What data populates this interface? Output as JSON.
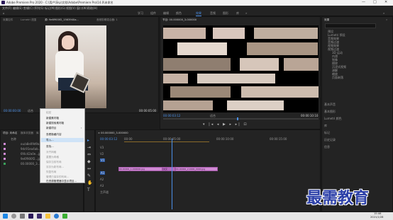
{
  "app_title": "Adobe Premiere Pro 2020 - C:\\用户\\Sky\\文档\\Adobe\\Premiere Pro\\14.0\\未命名",
  "window_controls": [
    "—",
    "□",
    "✕"
  ],
  "menu": [
    "文件(F)",
    "编辑(E)",
    "剪辑(C)",
    "序列(S)",
    "标记(M)",
    "图形(G)",
    "视图(V)",
    "窗口(W)",
    "帮助(H)"
  ],
  "workspaces": [
    "学习",
    "组件",
    "编辑",
    "颜色",
    "效果",
    "音频",
    "图形",
    "库",
    "»"
  ],
  "active_workspace": "效果",
  "source_panel": {
    "tabs": [
      "效果控件",
      "Lumetri 范围",
      "源: 9e6f900f2_1563940a...",
      "音频剪辑混合器: 1"
    ],
    "timecode": "00:00:00:00",
    "fit": "适合",
    "duration": "00:00:05:00"
  },
  "program_panel": {
    "tab": "节目: 00.000000_3-000000",
    "timecode": "00:00:03:12",
    "fit": "适合",
    "duration": "00:00:10:10"
  },
  "effects_panel": {
    "tabs": [
      "效果",
      "»"
    ],
    "search_placeholder": "",
    "items": [
      "预设",
      "Lumetri 预设",
      "音频效果",
      "音频过渡",
      "视频效果",
      "视频过渡",
      "3D 运动",
      "内滑",
      "划像",
      "擦除",
      "沉浸式视频",
      "溶解",
      "缩放",
      "页面剥落"
    ],
    "bottom_items": [
      "基本声音",
      "基本图形",
      "Lumetri 颜色",
      "库",
      "标记",
      "历史记录",
      "信息"
    ]
  },
  "project_panel": {
    "tabs": [
      "项目: 未命名",
      "媒体浏览器",
      "库",
      "信息",
      "»"
    ],
    "name_col": "名称",
    "files": [
      "ou/a8e09d9a...jpg",
      "9dc91ea4ab...jpg",
      "6f4c42a0e...jpg",
      "9e6f900f2...jpg",
      "00.00000_3..."
    ]
  },
  "timeline": {
    "tab": "× 00.000000_3-000000",
    "timecode": "00:00:03:12",
    "ruler": [
      "00:00",
      "00:00:05:00",
      "00:00:10:00",
      "00:00:15:00"
    ],
    "tracks": [
      "V3",
      "V2",
      "V1",
      "A1",
      "A2",
      "A3",
      "主声道"
    ],
    "clips": [
      "00.00000_1-000000.jpg",
      "交叉",
      "00.00000_2-0000_0000.jpg"
    ]
  },
  "context_menu": {
    "items": [
      {
        "label": "粘贴",
        "enabled": false
      },
      {
        "label": "新建素材箱",
        "enabled": true
      },
      {
        "label": "新建搜索素材箱",
        "enabled": true
      },
      {
        "label": "新建项目",
        "enabled": true,
        "submenu": true
      },
      {
        "label": "查看隐藏内容",
        "enabled": true
      },
      {
        "label": "导入...",
        "enabled": true,
        "highlighted": true
      },
      {
        "label": "查找...",
        "enabled": true
      },
      {
        "label": "对齐网格",
        "enabled": false
      },
      {
        "label": "重置为网格",
        "enabled": false
      },
      {
        "label": "保存当前布局",
        "enabled": false
      },
      {
        "label": "另存为新布局...",
        "enabled": false
      },
      {
        "label": "恢复布局",
        "enabled": false
      },
      {
        "label": "管理已保存的布局...",
        "enabled": false
      },
      {
        "label": "在资源管理器中显示项目...",
        "enabled": true
      }
    ]
  },
  "watermark": "最需教育",
  "taskbar": {
    "time": "15:46",
    "date": "2021/1/28"
  },
  "colors": {
    "accent": "#4a8fe7",
    "clip": "#d08ad4",
    "playhead": "#4a8fe7"
  }
}
